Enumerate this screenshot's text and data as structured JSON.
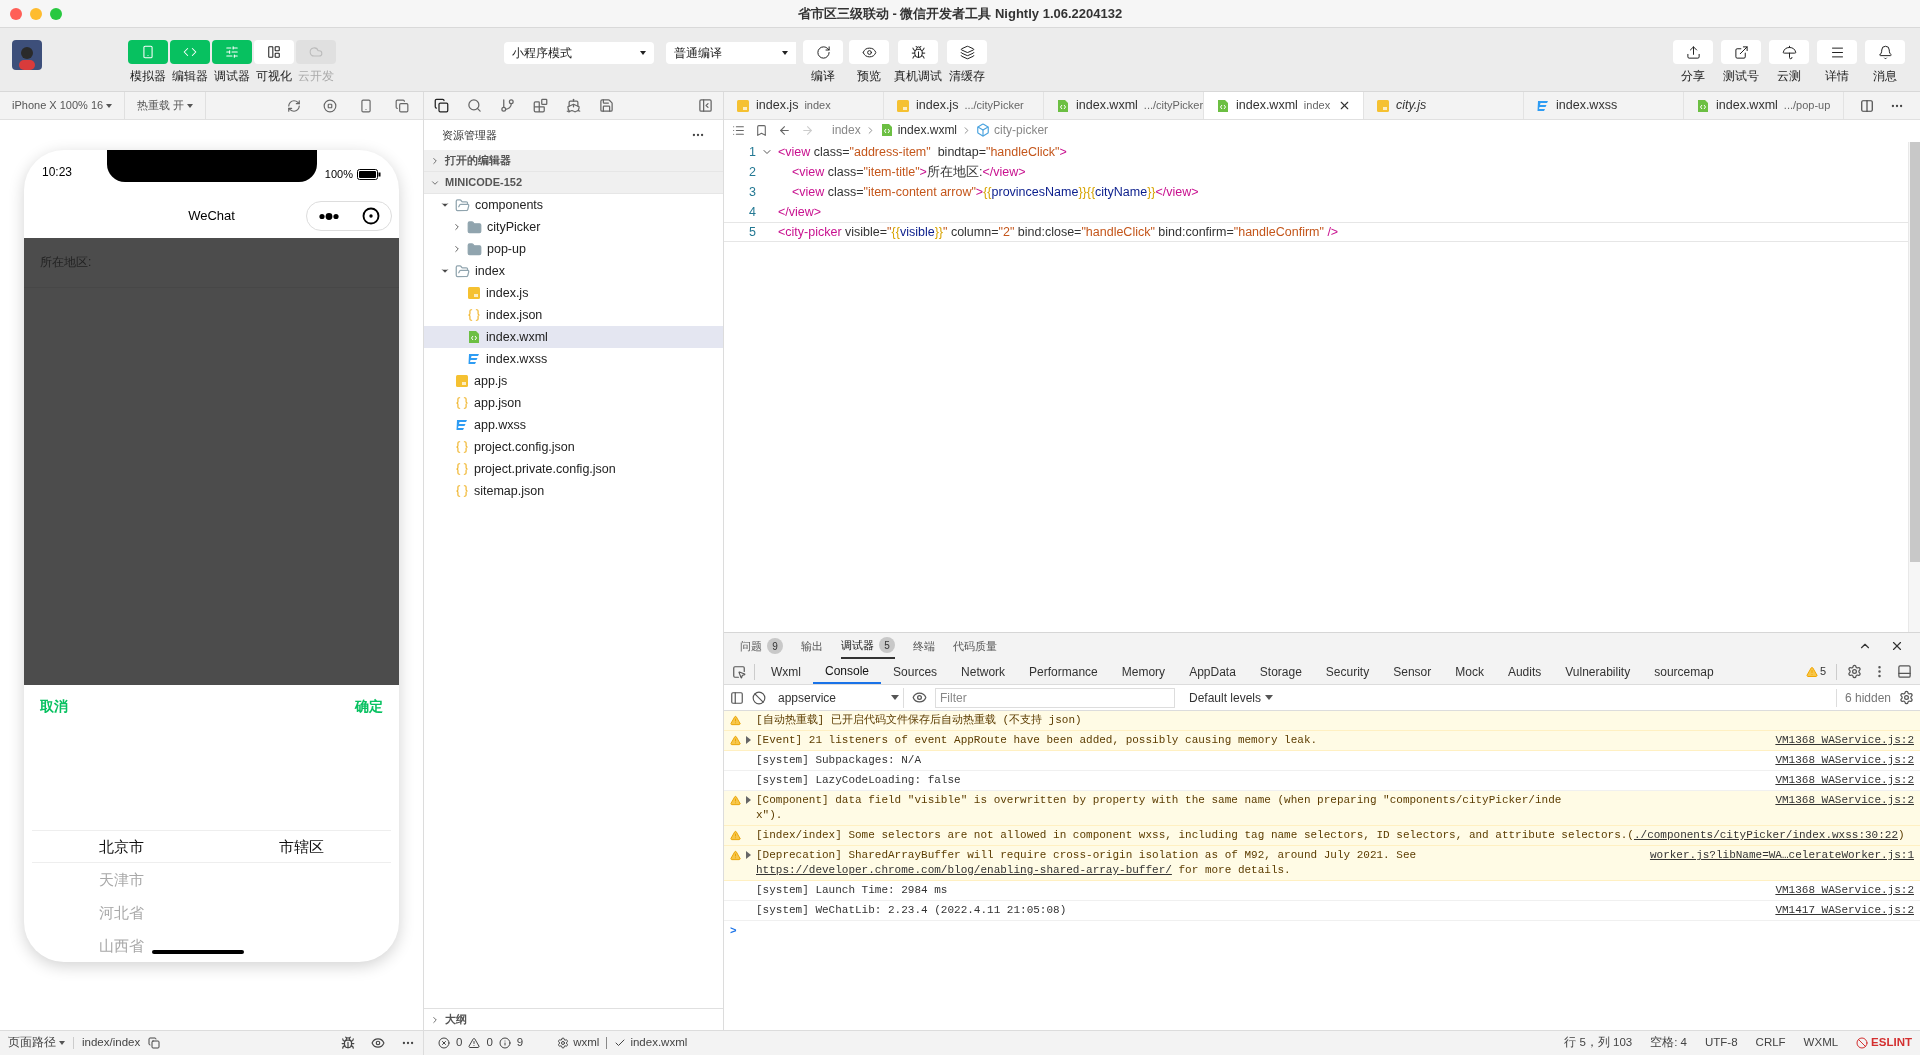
{
  "window": {
    "title": "省市区三级联动 - 微信开发者工具 Nightly 1.06.2204132"
  },
  "toolbar": {
    "view_buttons": [
      {
        "label": "模拟器",
        "on": true,
        "disabled": false
      },
      {
        "label": "编辑器",
        "on": true,
        "disabled": false
      },
      {
        "label": "调试器",
        "on": true,
        "disabled": false
      },
      {
        "label": "可视化",
        "on": false,
        "disabled": false
      },
      {
        "label": "云开发",
        "on": false,
        "disabled": true
      }
    ],
    "mode_select": "小程序模式",
    "compile_select": "普通编译",
    "actions": [
      "编译",
      "预览",
      "真机调试",
      "清缓存"
    ],
    "right_actions": [
      "分享",
      "测试号",
      "云测",
      "详情",
      "消息"
    ]
  },
  "simulator": {
    "device": "iPhone X 100% 16",
    "hot_reload": "热重载 开",
    "phone": {
      "time": "10:23",
      "battery": "100%",
      "nav_title": "WeChat",
      "field_label": "所在地区:",
      "cancel": "取消",
      "confirm": "确定",
      "columns": [
        {
          "options": [
            {
              "label": "北京市",
              "selected": true
            },
            {
              "label": "天津市",
              "selected": false
            },
            {
              "label": "河北省",
              "selected": false
            },
            {
              "label": "山西省",
              "selected": false
            }
          ]
        },
        {
          "options": [
            {
              "label": "市辖区",
              "selected": true
            }
          ]
        }
      ]
    }
  },
  "explorer": {
    "title": "资源管理器",
    "sections": [
      {
        "label": "打开的编辑器",
        "expanded": false
      },
      {
        "label": "MINICODE-152",
        "expanded": true
      }
    ],
    "tree": [
      {
        "name": "components",
        "kind": "folder",
        "expanded": true,
        "selected": false,
        "children": [
          {
            "name": "cityPicker",
            "kind": "folder",
            "expanded": false,
            "selected": false
          },
          {
            "name": "pop-up",
            "kind": "folder",
            "expanded": false,
            "selected": false
          }
        ]
      },
      {
        "name": "index",
        "kind": "folder",
        "expanded": true,
        "selected": false,
        "children": [
          {
            "name": "index.js",
            "kind": "js",
            "selected": false
          },
          {
            "name": "index.json",
            "kind": "json",
            "selected": false
          },
          {
            "name": "index.wxml",
            "kind": "wxml",
            "selected": true
          },
          {
            "name": "index.wxss",
            "kind": "wxss",
            "selected": false
          }
        ]
      },
      {
        "name": "app.js",
        "kind": "js",
        "selected": false
      },
      {
        "name": "app.json",
        "kind": "json",
        "selected": false
      },
      {
        "name": "app.wxss",
        "kind": "wxss",
        "selected": false
      },
      {
        "name": "project.config.json",
        "kind": "json",
        "selected": false
      },
      {
        "name": "project.private.config.json",
        "kind": "json",
        "selected": false
      },
      {
        "name": "sitemap.json",
        "kind": "json",
        "selected": false
      }
    ],
    "outline": {
      "label": "大纲",
      "expanded": false
    }
  },
  "editor": {
    "tabs": [
      {
        "name": "index.js",
        "path": "index",
        "kind": "js",
        "selected": false,
        "preview": false
      },
      {
        "name": "index.js",
        "path": ".../cityPicker",
        "kind": "js",
        "selected": false,
        "preview": false
      },
      {
        "name": "index.wxml",
        "path": ".../cityPicker",
        "kind": "wxml",
        "selected": false,
        "preview": false
      },
      {
        "name": "index.wxml",
        "path": "index",
        "kind": "wxml",
        "selected": true,
        "preview": false
      },
      {
        "name": "city.js",
        "kind": "js",
        "selected": false,
        "preview": true
      },
      {
        "name": "index.wxss",
        "kind": "wxss",
        "selected": false,
        "preview": false
      },
      {
        "name": "index.wxml",
        "path": ".../pop-up",
        "kind": "wxml",
        "selected": false,
        "preview": false
      }
    ],
    "breadcrumb": [
      {
        "label": "index",
        "kind": "folder"
      },
      {
        "label": "index.wxml",
        "kind": "wxml"
      },
      {
        "label": "city-picker",
        "kind": "element"
      }
    ],
    "lines": [
      {
        "number": "1",
        "foldable": true,
        "current": false,
        "tokens": [
          {
            "kind": "tag",
            "text": "<view"
          },
          {
            "kind": "attr",
            "text": " class="
          },
          {
            "kind": "string",
            "text": "\"address-item\""
          },
          {
            "kind": "attr",
            "text": "  bindtap="
          },
          {
            "kind": "string",
            "text": "\"handleClick\""
          },
          {
            "kind": "tag",
            "text": ">"
          }
        ]
      },
      {
        "number": "2",
        "foldable": false,
        "current": false,
        "tokens": [
          {
            "kind": "tag",
            "text": "    <view"
          },
          {
            "kind": "attr",
            "text": " class="
          },
          {
            "kind": "string",
            "text": "\"item-title\""
          },
          {
            "kind": "tag",
            "text": ">"
          },
          {
            "kind": "attr",
            "text": "所在地区:"
          },
          {
            "kind": "tag",
            "text": "</view>"
          }
        ]
      },
      {
        "number": "3",
        "foldable": false,
        "current": false,
        "tokens": [
          {
            "kind": "tag",
            "text": "    <view"
          },
          {
            "kind": "attr",
            "text": " class="
          },
          {
            "kind": "string",
            "text": "\"item-content arrow\""
          },
          {
            "kind": "tag",
            "text": ">"
          },
          {
            "kind": "brace",
            "text": "{{"
          },
          {
            "kind": "var",
            "text": "provincesName"
          },
          {
            "kind": "brace",
            "text": "}}"
          },
          {
            "kind": "brace",
            "text": "{{"
          },
          {
            "kind": "var",
            "text": "cityName"
          },
          {
            "kind": "brace",
            "text": "}}"
          },
          {
            "kind": "tag",
            "text": "</view>"
          }
        ]
      },
      {
        "number": "4",
        "foldable": false,
        "current": false,
        "tokens": [
          {
            "kind": "tag",
            "text": "</view>"
          }
        ]
      },
      {
        "number": "5",
        "foldable": false,
        "current": true,
        "tokens": [
          {
            "kind": "tag",
            "text": "<city-picker"
          },
          {
            "kind": "attr",
            "text": " visible="
          },
          {
            "kind": "string",
            "text": "\""
          },
          {
            "kind": "brace",
            "text": "{{"
          },
          {
            "kind": "var",
            "text": "visible"
          },
          {
            "kind": "brace",
            "text": "}}"
          },
          {
            "kind": "string",
            "text": "\""
          },
          {
            "kind": "attr",
            "text": " column="
          },
          {
            "kind": "string",
            "text": "\"2\""
          },
          {
            "kind": "attr",
            "text": " bind:close="
          },
          {
            "kind": "string",
            "text": "\"handleClick\""
          },
          {
            "kind": "attr",
            "text": " bind:confirm="
          },
          {
            "kind": "string",
            "text": "\"handleConfirm\""
          },
          {
            "kind": "tag",
            "text": " />"
          }
        ]
      }
    ]
  },
  "panel": {
    "tabs": [
      {
        "label": "问题",
        "count": "9",
        "selected": false
      },
      {
        "label": "输出",
        "selected": false
      },
      {
        "label": "调试器",
        "count": "5",
        "selected": true
      },
      {
        "label": "终端",
        "selected": false
      },
      {
        "label": "代码质量",
        "selected": false
      }
    ],
    "devtools_tabs": [
      {
        "label": "Wxml",
        "selected": false
      },
      {
        "label": "Console",
        "selected": true
      },
      {
        "label": "Sources",
        "selected": false
      },
      {
        "label": "Network",
        "selected": false
      },
      {
        "label": "Performance",
        "selected": false
      },
      {
        "label": "Memory",
        "selected": false
      },
      {
        "label": "AppData",
        "selected": false
      },
      {
        "label": "Storage",
        "selected": false
      },
      {
        "label": "Security",
        "selected": false
      },
      {
        "label": "Sensor",
        "selected": false
      },
      {
        "label": "Mock",
        "selected": false
      },
      {
        "label": "Audits",
        "selected": false
      },
      {
        "label": "Vulnerability",
        "selected": false
      },
      {
        "label": "sourcemap",
        "selected": false
      }
    ],
    "warning_count": "5",
    "context": "appservice",
    "filter_placeholder": "Filter",
    "levels": "Default levels",
    "hidden": "6 hidden",
    "messages": [
      {
        "kind": "warning",
        "expandable": false,
        "parts": [
          {
            "kind": "text",
            "text": "[自动热重载] 已开启代码文件保存后自动热重载 (不支持 json)"
          }
        ]
      },
      {
        "kind": "warning",
        "expandable": true,
        "parts": [
          {
            "kind": "text",
            "text": "[Event] 21 listeners of event AppRoute have been added, possibly causing memory leak."
          }
        ],
        "source": "VM1368 WAService.js:2"
      },
      {
        "kind": "info",
        "expandable": false,
        "parts": [
          {
            "kind": "text",
            "text": "[system] Subpackages: N/A"
          }
        ],
        "source": "VM1368 WAService.js:2"
      },
      {
        "kind": "info",
        "expandable": false,
        "parts": [
          {
            "kind": "text",
            "text": "[system] LazyCodeLoading: false"
          }
        ],
        "source": "VM1368 WAService.js:2"
      },
      {
        "kind": "warning",
        "expandable": true,
        "parts": [
          {
            "kind": "text",
            "text": "[Component] data field \"visible\" is overwritten by property with the same name (when preparing \"components/cityPicker/index\")."
          }
        ],
        "source": "VM1368 WAService.js:2"
      },
      {
        "kind": "warning",
        "expandable": false,
        "parts": [
          {
            "kind": "text",
            "text": "[index/index] Some selectors are not allowed in component wxss, including tag name selectors, ID selectors, and attribute selectors.("
          },
          {
            "kind": "link",
            "text": "./components/cityPicker/index.wxss:30:22"
          },
          {
            "kind": "text",
            "text": ")"
          }
        ]
      },
      {
        "kind": "warning",
        "expandable": true,
        "parts": [
          {
            "kind": "text",
            "text": "[Deprecation] SharedArrayBuffer will require cross-origin isolation as of M92, around July 2021. See "
          },
          {
            "kind": "link",
            "text": "https://developer.chrome.com/blog/enabling-shared-array-buffer/"
          },
          {
            "kind": "text",
            "text": " for more details."
          }
        ],
        "source": "worker.js?libName=WA…celerateWorker.js:1"
      },
      {
        "kind": "info",
        "expandable": false,
        "parts": [
          {
            "kind": "text",
            "text": "[system] Launch Time: 2984 ms"
          }
        ],
        "source": "VM1368 WAService.js:2"
      },
      {
        "kind": "info",
        "expandable": false,
        "parts": [
          {
            "kind": "text",
            "text": "[system] WeChatLib: 2.23.4 (2022.4.11 21:05:08)"
          }
        ],
        "source": "VM1417 WAService.js:2"
      }
    ],
    "prompt": ">"
  },
  "status_bar": {
    "path_label": "页面路径",
    "page": "index/index",
    "errors": "0",
    "warnings": "0",
    "infos": "9",
    "language": "wxml",
    "file": "index.wxml",
    "items": [
      "行 5，列 103",
      "空格: 4",
      "UTF-8",
      "CRLF",
      "WXML"
    ],
    "eslint": "ESLINT"
  }
}
